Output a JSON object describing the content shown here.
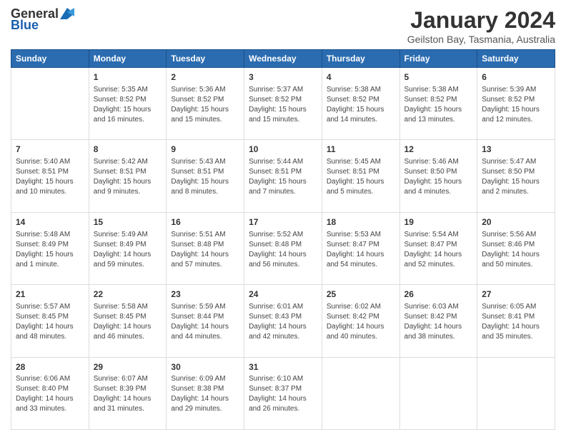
{
  "header": {
    "logo_general": "General",
    "logo_blue": "Blue",
    "month_title": "January 2024",
    "location": "Geilston Bay, Tasmania, Australia"
  },
  "days_of_week": [
    "Sunday",
    "Monday",
    "Tuesday",
    "Wednesday",
    "Thursday",
    "Friday",
    "Saturday"
  ],
  "weeks": [
    [
      {
        "date": "",
        "info": ""
      },
      {
        "date": "1",
        "info": "Sunrise: 5:35 AM\nSunset: 8:52 PM\nDaylight: 15 hours\nand 16 minutes."
      },
      {
        "date": "2",
        "info": "Sunrise: 5:36 AM\nSunset: 8:52 PM\nDaylight: 15 hours\nand 15 minutes."
      },
      {
        "date": "3",
        "info": "Sunrise: 5:37 AM\nSunset: 8:52 PM\nDaylight: 15 hours\nand 15 minutes."
      },
      {
        "date": "4",
        "info": "Sunrise: 5:38 AM\nSunset: 8:52 PM\nDaylight: 15 hours\nand 14 minutes."
      },
      {
        "date": "5",
        "info": "Sunrise: 5:38 AM\nSunset: 8:52 PM\nDaylight: 15 hours\nand 13 minutes."
      },
      {
        "date": "6",
        "info": "Sunrise: 5:39 AM\nSunset: 8:52 PM\nDaylight: 15 hours\nand 12 minutes."
      }
    ],
    [
      {
        "date": "7",
        "info": "Sunrise: 5:40 AM\nSunset: 8:51 PM\nDaylight: 15 hours\nand 10 minutes."
      },
      {
        "date": "8",
        "info": "Sunrise: 5:42 AM\nSunset: 8:51 PM\nDaylight: 15 hours\nand 9 minutes."
      },
      {
        "date": "9",
        "info": "Sunrise: 5:43 AM\nSunset: 8:51 PM\nDaylight: 15 hours\nand 8 minutes."
      },
      {
        "date": "10",
        "info": "Sunrise: 5:44 AM\nSunset: 8:51 PM\nDaylight: 15 hours\nand 7 minutes."
      },
      {
        "date": "11",
        "info": "Sunrise: 5:45 AM\nSunset: 8:51 PM\nDaylight: 15 hours\nand 5 minutes."
      },
      {
        "date": "12",
        "info": "Sunrise: 5:46 AM\nSunset: 8:50 PM\nDaylight: 15 hours\nand 4 minutes."
      },
      {
        "date": "13",
        "info": "Sunrise: 5:47 AM\nSunset: 8:50 PM\nDaylight: 15 hours\nand 2 minutes."
      }
    ],
    [
      {
        "date": "14",
        "info": "Sunrise: 5:48 AM\nSunset: 8:49 PM\nDaylight: 15 hours\nand 1 minute."
      },
      {
        "date": "15",
        "info": "Sunrise: 5:49 AM\nSunset: 8:49 PM\nDaylight: 14 hours\nand 59 minutes."
      },
      {
        "date": "16",
        "info": "Sunrise: 5:51 AM\nSunset: 8:48 PM\nDaylight: 14 hours\nand 57 minutes."
      },
      {
        "date": "17",
        "info": "Sunrise: 5:52 AM\nSunset: 8:48 PM\nDaylight: 14 hours\nand 56 minutes."
      },
      {
        "date": "18",
        "info": "Sunrise: 5:53 AM\nSunset: 8:47 PM\nDaylight: 14 hours\nand 54 minutes."
      },
      {
        "date": "19",
        "info": "Sunrise: 5:54 AM\nSunset: 8:47 PM\nDaylight: 14 hours\nand 52 minutes."
      },
      {
        "date": "20",
        "info": "Sunrise: 5:56 AM\nSunset: 8:46 PM\nDaylight: 14 hours\nand 50 minutes."
      }
    ],
    [
      {
        "date": "21",
        "info": "Sunrise: 5:57 AM\nSunset: 8:45 PM\nDaylight: 14 hours\nand 48 minutes."
      },
      {
        "date": "22",
        "info": "Sunrise: 5:58 AM\nSunset: 8:45 PM\nDaylight: 14 hours\nand 46 minutes."
      },
      {
        "date": "23",
        "info": "Sunrise: 5:59 AM\nSunset: 8:44 PM\nDaylight: 14 hours\nand 44 minutes."
      },
      {
        "date": "24",
        "info": "Sunrise: 6:01 AM\nSunset: 8:43 PM\nDaylight: 14 hours\nand 42 minutes."
      },
      {
        "date": "25",
        "info": "Sunrise: 6:02 AM\nSunset: 8:42 PM\nDaylight: 14 hours\nand 40 minutes."
      },
      {
        "date": "26",
        "info": "Sunrise: 6:03 AM\nSunset: 8:42 PM\nDaylight: 14 hours\nand 38 minutes."
      },
      {
        "date": "27",
        "info": "Sunrise: 6:05 AM\nSunset: 8:41 PM\nDaylight: 14 hours\nand 35 minutes."
      }
    ],
    [
      {
        "date": "28",
        "info": "Sunrise: 6:06 AM\nSunset: 8:40 PM\nDaylight: 14 hours\nand 33 minutes."
      },
      {
        "date": "29",
        "info": "Sunrise: 6:07 AM\nSunset: 8:39 PM\nDaylight: 14 hours\nand 31 minutes."
      },
      {
        "date": "30",
        "info": "Sunrise: 6:09 AM\nSunset: 8:38 PM\nDaylight: 14 hours\nand 29 minutes."
      },
      {
        "date": "31",
        "info": "Sunrise: 6:10 AM\nSunset: 8:37 PM\nDaylight: 14 hours\nand 26 minutes."
      },
      {
        "date": "",
        "info": ""
      },
      {
        "date": "",
        "info": ""
      },
      {
        "date": "",
        "info": ""
      }
    ]
  ]
}
